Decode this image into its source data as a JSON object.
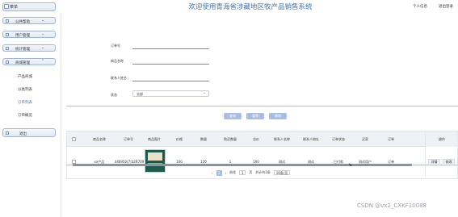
{
  "header": {
    "menu_label": "菜单",
    "title": "欢迎使用青海省涉藏地区牧产品销售系统",
    "links": [
      "个人信息",
      "退出登录"
    ]
  },
  "sidebar": {
    "groups": [
      "公共帮助",
      "用户管理",
      "统计管理",
      "商城管理"
    ],
    "subitems": [
      "产品商城",
      "分类列表",
      "订单列表",
      "订单概览"
    ],
    "active_subitem": "订单列表",
    "logout": "退出"
  },
  "filters": {
    "order_no": "订单号",
    "product_name": "商品名称",
    "contact_name": "联系人姓名",
    "status_label": "状态",
    "status_value": "全部"
  },
  "actions": {
    "search": "查询",
    "reset": "重置",
    "delete": "删除"
  },
  "table": {
    "columns": [
      "商品名称",
      "订单号",
      "商品图片",
      "价格",
      "数量",
      "购买数量",
      "总价",
      "联系人名称",
      "联系人地址",
      "订单状态",
      "买家",
      "订单"
    ],
    "operation_header": "操作",
    "rows": [
      {
        "name": "xx产品",
        "order_no": "446950(7)32B709",
        "price": "100",
        "qty": "120",
        "buy_qty": "1",
        "total": "100",
        "contact_name": "测试",
        "contact_addr": "测试",
        "status": "已付款",
        "buyer": "测试用户",
        "order": "订单"
      }
    ],
    "row_buttons": [
      "详情",
      "修改"
    ]
  },
  "pager": {
    "current_page": "1",
    "goto_prefix": "前往",
    "goto_page": "1",
    "page_suffix": "页",
    "total_text": "共计共1条",
    "page_size": "10条/页"
  },
  "watermark": "CSDN @vx2_CXKF10088"
}
